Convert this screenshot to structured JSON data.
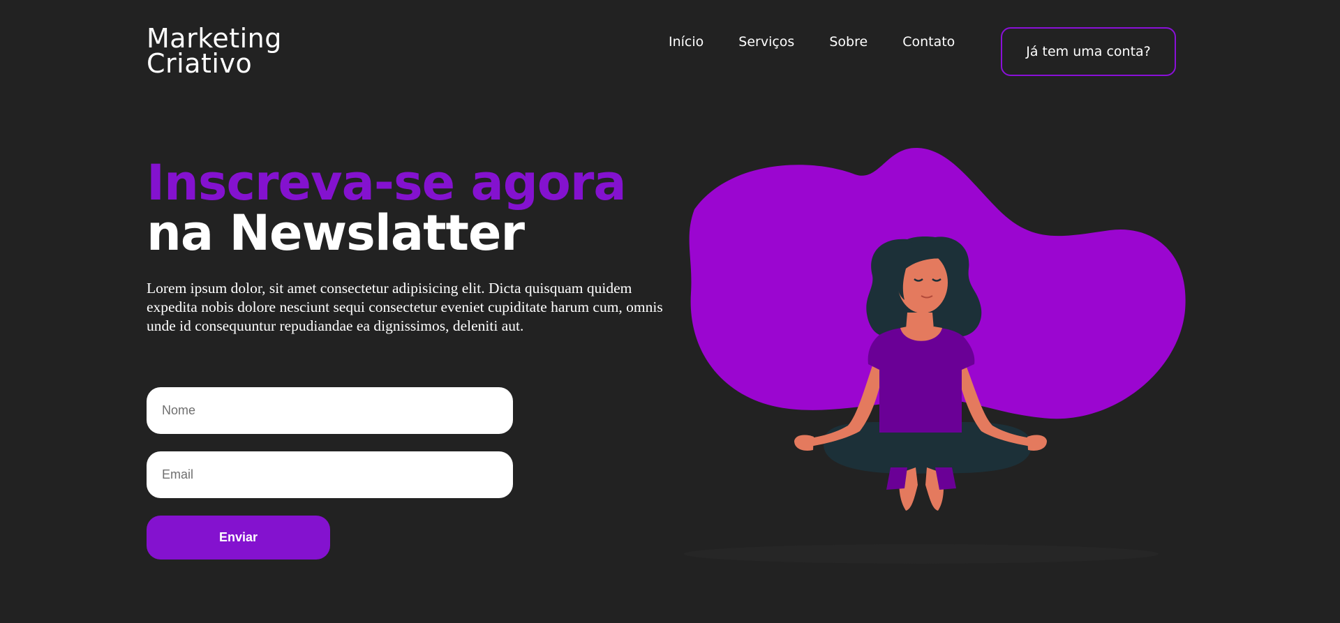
{
  "header": {
    "logo_line1": "Marketing",
    "logo_line2": "Criativo",
    "nav": [
      {
        "label": "Início"
      },
      {
        "label": "Serviços"
      },
      {
        "label": "Sobre"
      },
      {
        "label": "Contato"
      }
    ],
    "account_button": "Já tem uma conta?"
  },
  "hero": {
    "headline_line1": "Inscreva-se agora",
    "headline_line2": "na Newslatter",
    "description": "Lorem ipsum dolor, sit amet consectetur adipisicing elit. Dicta quisquam quidem expedita nobis dolore nesciunt sequi consectetur eveniet cupiditate harum cum, omnis unde id consequuntur repudiandae ea dignissimos, deleniti aut."
  },
  "form": {
    "name_placeholder": "Nome",
    "name_value": "",
    "email_placeholder": "Email",
    "email_value": "",
    "submit_label": "Enviar"
  },
  "illustration": {
    "subject": "woman-meditating-illustration"
  },
  "colors": {
    "background": "#222222",
    "accent": "#8412cf",
    "blob": "#9b06d0",
    "text": "#ffffff"
  }
}
